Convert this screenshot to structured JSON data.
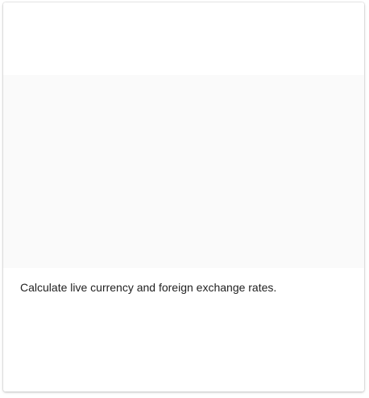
{
  "card": {
    "description": "Calculate live currency and foreign exchange rates."
  }
}
